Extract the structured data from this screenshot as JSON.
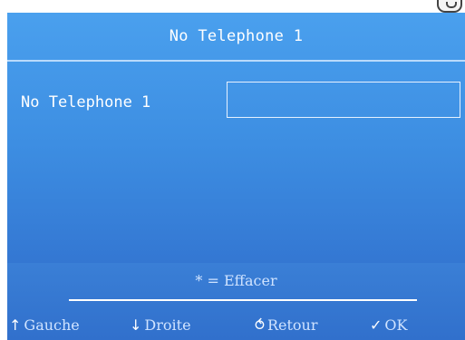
{
  "header": {
    "title": "No Telephone 1"
  },
  "form": {
    "field_label": "No Telephone 1",
    "field_value": "",
    "field_placeholder": ""
  },
  "hint": {
    "text": "* = Effacer"
  },
  "softkeys": [
    {
      "glyph": "↑",
      "label": "Gauche",
      "icon": "arrow-up-icon"
    },
    {
      "glyph": "↓",
      "label": "Droite",
      "icon": "arrow-down-icon"
    },
    {
      "glyph": "⥀",
      "label": "Retour",
      "icon": "return-icon"
    },
    {
      "glyph": "✓",
      "label": "OK",
      "icon": "check-icon"
    }
  ],
  "colors": {
    "screen_top": "#4aa0ee",
    "screen_bottom": "#2e64c0",
    "text": "#ffffff",
    "muted_text": "#cfe3ff"
  }
}
